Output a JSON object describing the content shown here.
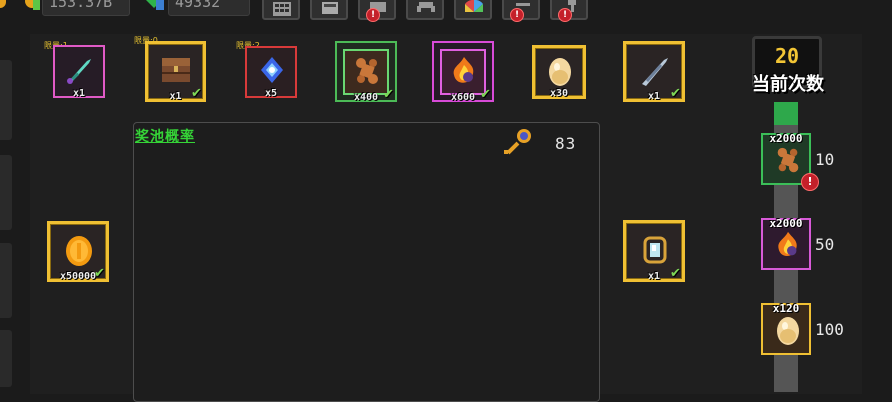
{
  "currency": {
    "gold_amount": "153.37B",
    "gem_amount": "49332",
    "gold_icon": "gold-coin-icon",
    "gem_icon": "green-gem-icon"
  },
  "menu_buttons": [
    {
      "icon": "calculator-icon",
      "badge": ""
    },
    {
      "icon": "box-icon",
      "badge": ""
    },
    {
      "icon": "equipment-icon",
      "badge": "!"
    },
    {
      "icon": "invader-icon",
      "badge": ""
    },
    {
      "icon": "pie-wheel-icon",
      "badge": ""
    },
    {
      "icon": "pickaxe-icon",
      "badge": "!"
    },
    {
      "icon": "hammer-icon",
      "badge": "!"
    }
  ],
  "top_rewards": [
    {
      "icon": "dagger-icon",
      "qty": "x1",
      "limit": "限量:1",
      "claimed": false
    },
    {
      "icon": "chest-icon",
      "qty": "x1",
      "limit": "限量:0",
      "claimed": true
    },
    {
      "icon": "crystal-icon",
      "qty": "x5",
      "limit": "限量:2",
      "claimed": false
    },
    {
      "icon": "bone-icon",
      "qty": "x400",
      "limit": "",
      "claimed": true
    },
    {
      "icon": "fire-orb-icon",
      "qty": "x600",
      "limit": "",
      "claimed": true
    },
    {
      "icon": "egg-icon",
      "qty": "x30",
      "limit": "",
      "claimed": false
    },
    {
      "icon": "feather-blade-icon",
      "qty": "x1",
      "limit": "",
      "claimed": true
    }
  ],
  "side_rewards": [
    {
      "icon": "coin-icon",
      "qty": "x50000",
      "claimed": true
    },
    {
      "icon": "gem-ring-icon",
      "qty": "x1",
      "claimed": true
    }
  ],
  "pool": {
    "title": "奖池概率",
    "key_icon": "key-icon",
    "count": "83"
  },
  "counter": {
    "value": "20",
    "label": "当前次数"
  },
  "progress": {
    "fill_fraction": 0.08
  },
  "milestones": [
    {
      "icon": "bone-icon",
      "qty": "x2000",
      "threshold": "10",
      "badge": "!"
    },
    {
      "icon": "fire-orb-icon",
      "qty": "x2000",
      "threshold": "50",
      "badge": ""
    },
    {
      "icon": "egg-icon",
      "qty": "x120",
      "threshold": "100",
      "badge": ""
    }
  ],
  "colors": {
    "gold_border": "#f0c033",
    "green_text": "#35d437",
    "progress_green": "#2ea84b"
  }
}
